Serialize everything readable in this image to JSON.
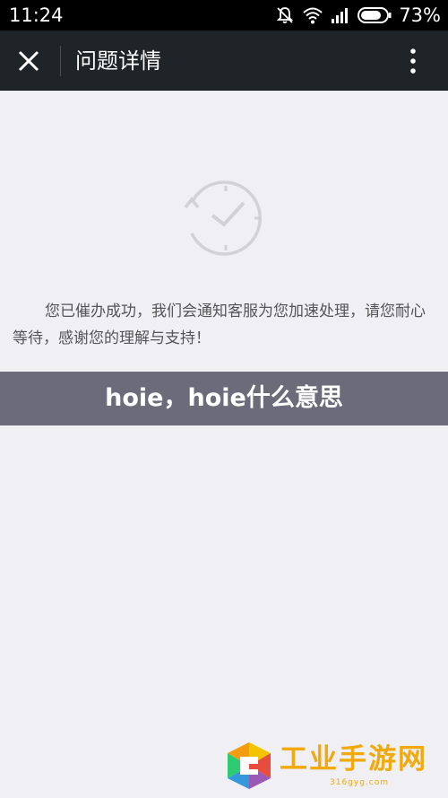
{
  "status_bar": {
    "time": "11:24",
    "battery_percent": "73%",
    "icons": [
      "mute-icon",
      "wifi-icon",
      "signal-icon",
      "battery-icon"
    ]
  },
  "title_bar": {
    "title": "问题详情",
    "close_icon": "close-icon",
    "menu_icon": "more-vert-icon"
  },
  "content": {
    "illustration_icon": "clock-refresh-icon",
    "message": "您已催办成功，我们会通知客服为您加速处理，请您耐心等待，感谢您的理解与支持！"
  },
  "banner": {
    "text": "hoie，hoie什么意思"
  },
  "watermark": {
    "text": "工业手游网",
    "url": "316gyg.com"
  },
  "colors": {
    "status_bar_bg": "#000000",
    "title_bar_bg": "#1f2428",
    "page_bg": "#efeff4",
    "banner_bg": "#6b6b7a",
    "watermark_accent": "#f2a90b"
  }
}
